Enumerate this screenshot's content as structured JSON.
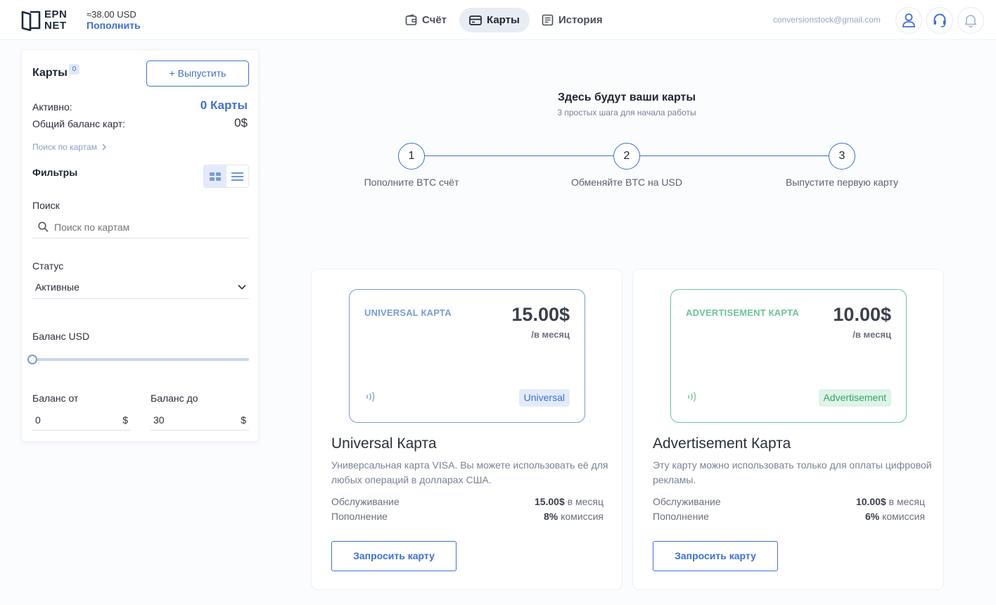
{
  "header": {
    "logo_line1": "EPN",
    "logo_line2": "NET",
    "balance_amount": "≈38.00 USD",
    "topup_label": "Пополнить",
    "nav": [
      {
        "label": "Счёт",
        "icon": "wallet-icon"
      },
      {
        "label": "Карты",
        "icon": "card-icon",
        "active": true
      },
      {
        "label": "История",
        "icon": "history-icon"
      }
    ],
    "email": "conversionstock@gmail.com",
    "icons": [
      "user-icon",
      "support-headset-icon",
      "bell-icon"
    ]
  },
  "sidebar": {
    "title": "Карты",
    "badge": "0",
    "issue_button": "+ Выпустить",
    "active_label": "Активно:",
    "active_value": "0 Карты",
    "total_label": "Общий баланс карт:",
    "total_value": "0$",
    "search_link": "Поиск по картам",
    "filters_title": "Фильтры",
    "search_label": "Поиск",
    "search_placeholder": "Поиск по картам",
    "status_label": "Статус",
    "status_value": "Активные",
    "balance_label": "Баланс USD",
    "balance_slider_value": 0,
    "from_label": "Баланс от",
    "from_value": "0",
    "to_label": "Баланс до",
    "to_value": "30",
    "currency": "$"
  },
  "main": {
    "title": "Здесь будут ваши карты",
    "subtitle": "3 простых шага для начала работы",
    "steps": [
      {
        "number": "1",
        "label": "Пополните BTC счёт"
      },
      {
        "number": "2",
        "label": "Обменяйте BTC на USD"
      },
      {
        "number": "3",
        "label": "Выпустите первую карту"
      }
    ],
    "cards": [
      {
        "visual_name": "UNIVERSAL КАРТА",
        "price": "15.00$",
        "period": "/в месяц",
        "tag": "Universal",
        "title": "Universal Карта",
        "description": "Универсальная карта VISA. Вы можете использовать её для любых операций в долларах США.",
        "service_label": "Обслуживание",
        "service_value": "15.00$",
        "service_suffix": " в месяц",
        "topup_label": "Пополнение",
        "topup_value": "8%",
        "topup_suffix": " комиссия",
        "button": "Запросить карту",
        "accent": "#7a9bd8",
        "tag_bg": "#e3ebfa",
        "tag_color": "#3e6fd8"
      },
      {
        "visual_name": "ADVERTISEMENT КАРТА",
        "price": "10.00$",
        "period": "/в месяц",
        "tag": "Advertisement",
        "title": "Advertisement Карта",
        "description": "Эту карту можно использовать только для оплаты цифровой рекламы.",
        "service_label": "Обслуживание",
        "service_value": "10.00$",
        "service_suffix": " в месяц",
        "topup_label": "Пополнение",
        "topup_value": "6%",
        "topup_suffix": " комиссия",
        "button": "Запросить карту",
        "accent": "#6cc49a",
        "tag_bg": "#dff3e8",
        "tag_color": "#35a46a"
      }
    ]
  }
}
